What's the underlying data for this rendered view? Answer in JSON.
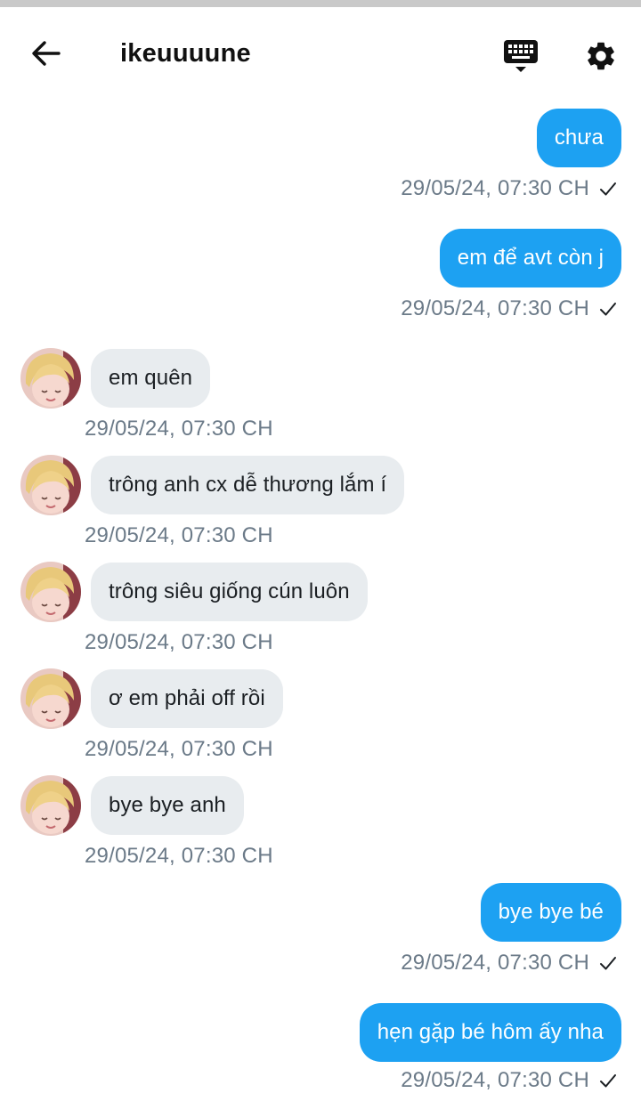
{
  "header": {
    "title": "ikeuuuune",
    "back_icon": "arrow-left-icon",
    "keyboard_icon": "keyboard-icon",
    "settings_icon": "gear-icon"
  },
  "colors": {
    "outgoing_bubble": "#1da1f2",
    "incoming_bubble": "#e8ecef",
    "timestamp": "#6b7a88"
  },
  "messages": [
    {
      "direction": "out",
      "text": "chưa",
      "time": "29/05/24, 07:30 CH"
    },
    {
      "direction": "out",
      "text": "em để avt còn j",
      "time": "29/05/24, 07:30 CH"
    },
    {
      "direction": "in",
      "text": "em quên",
      "time": "29/05/24, 07:30 CH"
    },
    {
      "direction": "in",
      "text": "trông anh cx dễ thương lắm í",
      "time": "29/05/24, 07:30 CH"
    },
    {
      "direction": "in",
      "text": "trông siêu giống cún luôn",
      "time": "29/05/24, 07:30 CH"
    },
    {
      "direction": "in",
      "text": "ơ em phải off rồi",
      "time": "29/05/24, 07:30 CH"
    },
    {
      "direction": "in",
      "text": "bye bye anh",
      "time": "29/05/24, 07:30 CH"
    },
    {
      "direction": "out",
      "text": "bye bye bé",
      "time": "29/05/24, 07:30 CH"
    },
    {
      "direction": "out",
      "text": "hẹn gặp bé hôm ấy nha",
      "time": "29/05/24, 07:30 CH"
    }
  ]
}
